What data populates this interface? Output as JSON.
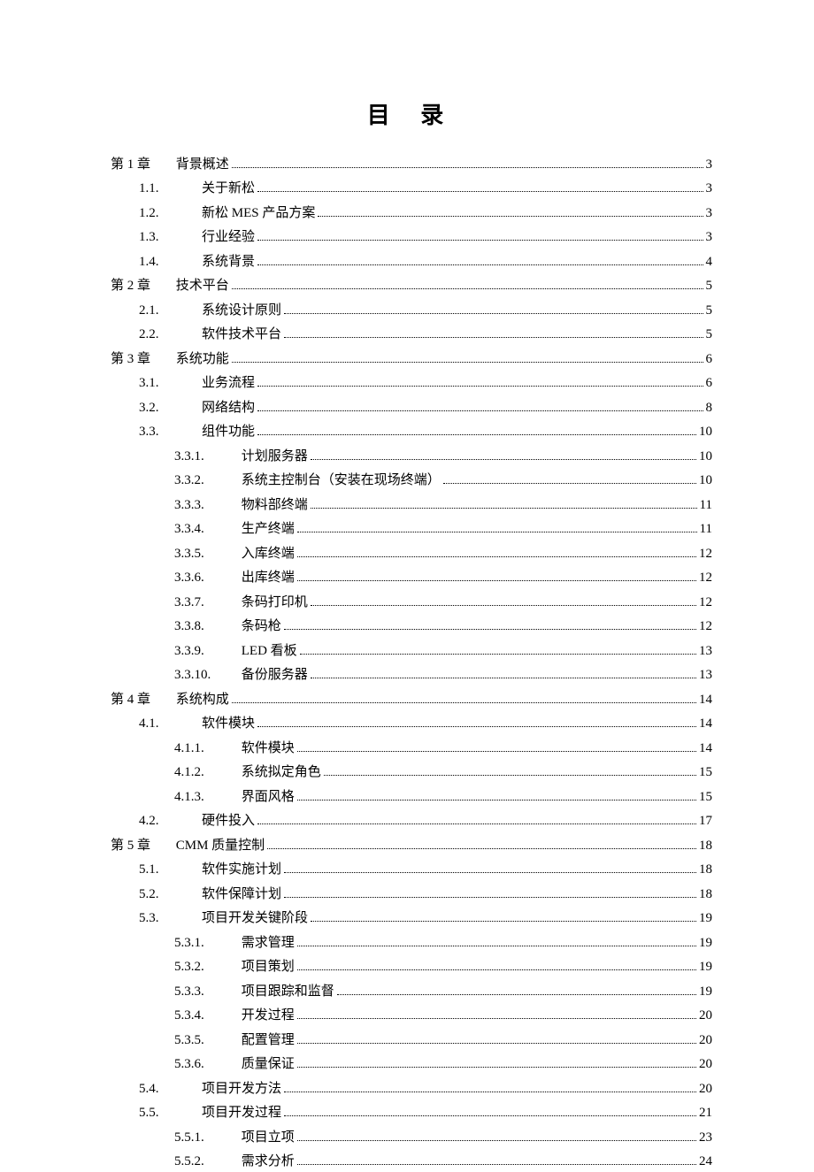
{
  "title": "目 录",
  "entries": [
    {
      "level": 0,
      "num": "第 1 章",
      "text": "背景概述",
      "page": "3"
    },
    {
      "level": 1,
      "num": "1.1.",
      "text": "关于新松",
      "page": "3"
    },
    {
      "level": 1,
      "num": "1.2.",
      "text": "新松 MES 产品方案 ",
      "page": "3"
    },
    {
      "level": 1,
      "num": "1.3.",
      "text": "行业经验",
      "page": "3"
    },
    {
      "level": 1,
      "num": "1.4.",
      "text": "系统背景",
      "page": "4"
    },
    {
      "level": 0,
      "num": "第 2 章",
      "text": "技术平台",
      "page": "5"
    },
    {
      "level": 1,
      "num": "2.1.",
      "text": "系统设计原则",
      "page": "5"
    },
    {
      "level": 1,
      "num": "2.2.",
      "text": "软件技术平台",
      "page": "5"
    },
    {
      "level": 0,
      "num": "第 3 章",
      "text": "系统功能",
      "page": "6"
    },
    {
      "level": 1,
      "num": "3.1.",
      "text": "业务流程",
      "page": "6"
    },
    {
      "level": 1,
      "num": "3.2.",
      "text": "网络结构",
      "page": "8"
    },
    {
      "level": 1,
      "num": "3.3.",
      "text": "组件功能",
      "page": "10"
    },
    {
      "level": 2,
      "num": "3.3.1.",
      "text": "计划服务器",
      "page": "10"
    },
    {
      "level": 2,
      "num": "3.3.2.",
      "text": "系统主控制台（安装在现场终端）",
      "page": "10"
    },
    {
      "level": 2,
      "num": "3.3.3.",
      "text": "物料部终端",
      "page": "11"
    },
    {
      "level": 2,
      "num": "3.3.4.",
      "text": "生产终端",
      "page": "11"
    },
    {
      "level": 2,
      "num": "3.3.5.",
      "text": "入库终端",
      "page": "12"
    },
    {
      "level": 2,
      "num": "3.3.6.",
      "text": "出库终端",
      "page": "12"
    },
    {
      "level": 2,
      "num": "3.3.7.",
      "text": "条码打印机",
      "page": "12"
    },
    {
      "level": 2,
      "num": "3.3.8.",
      "text": "条码枪",
      "page": "12"
    },
    {
      "level": 2,
      "num": "3.3.9.",
      "text": "LED 看板",
      "page": "13"
    },
    {
      "level": 2,
      "num": "3.3.10.",
      "text": "备份服务器",
      "page": "13"
    },
    {
      "level": 0,
      "num": "第 4 章",
      "text": "系统构成",
      "page": "14"
    },
    {
      "level": 1,
      "num": "4.1.",
      "text": "软件模块",
      "page": "14"
    },
    {
      "level": 2,
      "num": "4.1.1.",
      "text": "软件模块",
      "page": "14"
    },
    {
      "level": 2,
      "num": "4.1.2.",
      "text": "系统拟定角色",
      "page": "15"
    },
    {
      "level": 2,
      "num": "4.1.3.",
      "text": "界面风格",
      "page": "15"
    },
    {
      "level": 1,
      "num": "4.2.",
      "text": "硬件投入",
      "page": "17"
    },
    {
      "level": 0,
      "num": "第 5 章",
      "text": "CMM 质量控制",
      "page": "18"
    },
    {
      "level": 1,
      "num": "5.1.",
      "text": "软件实施计划",
      "page": "18"
    },
    {
      "level": 1,
      "num": "5.2.",
      "text": "软件保障计划",
      "page": "18"
    },
    {
      "level": 1,
      "num": "5.3.",
      "text": "项目开发关键阶段",
      "page": "19"
    },
    {
      "level": 2,
      "num": "5.3.1.",
      "text": "需求管理",
      "page": "19"
    },
    {
      "level": 2,
      "num": "5.3.2.",
      "text": "项目策划",
      "page": "19"
    },
    {
      "level": 2,
      "num": "5.3.3.",
      "text": "项目跟踪和监督",
      "page": "19"
    },
    {
      "level": 2,
      "num": "5.3.4.",
      "text": "开发过程",
      "page": "20"
    },
    {
      "level": 2,
      "num": "5.3.5.",
      "text": "配置管理",
      "page": "20"
    },
    {
      "level": 2,
      "num": "5.3.6.",
      "text": "质量保证",
      "page": "20"
    },
    {
      "level": 1,
      "num": "5.4.",
      "text": "项目开发方法",
      "page": "20"
    },
    {
      "level": 1,
      "num": "5.5.",
      "text": "项目开发过程",
      "page": "21"
    },
    {
      "level": 2,
      "num": "5.5.1.",
      "text": "项目立项",
      "page": "23"
    },
    {
      "level": 2,
      "num": "5.5.2.",
      "text": "需求分析",
      "page": "24"
    }
  ]
}
